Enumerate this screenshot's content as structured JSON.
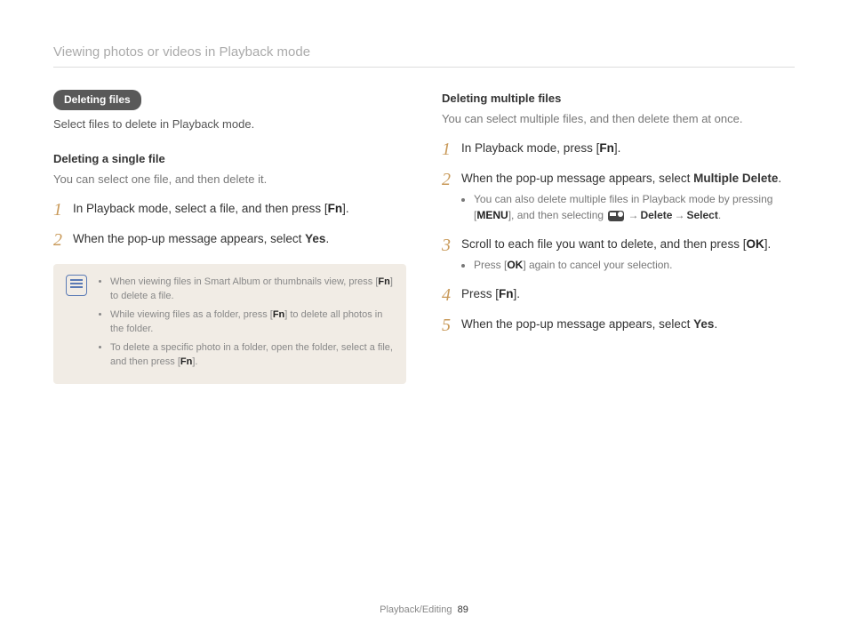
{
  "header": "Viewing photos or videos in Playback mode",
  "left": {
    "pill": "Deleting files",
    "intro": "Select files to delete in Playback mode.",
    "subhead": "Deleting a single file",
    "subintro": "You can select one file, and then delete it.",
    "step1_a": "In Playback mode, select a file, and then press [",
    "step1_key": "Fn",
    "step1_b": "].",
    "step2_a": "When the pop-up message appears, select ",
    "step2_bold": "Yes",
    "step2_b": ".",
    "note1_a": "When viewing files in Smart Album or thumbnails view, press [",
    "note1_key": "Fn",
    "note1_b": "] to delete a file.",
    "note2_a": "While viewing files as a folder, press [",
    "note2_key": "Fn",
    "note2_b": "] to delete all photos in the folder.",
    "note3_a": "To delete a specific photo in a folder, open the folder, select a file, and then press [",
    "note3_key": "Fn",
    "note3_b": "]."
  },
  "right": {
    "subhead": "Deleting multiple files",
    "subintro": "You can select multiple files, and then delete them at once.",
    "step1_a": "In Playback mode, press [",
    "step1_key": "Fn",
    "step1_b": "].",
    "step2_a": "When the pop-up message appears, select ",
    "step2_bold": "Multiple Delete",
    "step2_b": ".",
    "step2_sub_a": "You can also delete multiple files in Playback mode by pressing [",
    "step2_sub_key": "MENU",
    "step2_sub_b": "], and then selecting ",
    "step2_sub_arrow": "→",
    "step2_sub_d": "Delete",
    "step2_sub_e": "Select",
    "step2_sub_f": ".",
    "step3_a": "Scroll to each file you want to delete, and then press [",
    "step3_key": "OK",
    "step3_b": "].",
    "step3_sub_a": "Press [",
    "step3_sub_key": "OK",
    "step3_sub_b": "] again to cancel your selection.",
    "step4_a": "Press [",
    "step4_key": "Fn",
    "step4_b": "].",
    "step5_a": "When the pop-up message appears, select ",
    "step5_bold": "Yes",
    "step5_b": "."
  },
  "footer": {
    "section": "Playback/Editing",
    "page": "89"
  }
}
